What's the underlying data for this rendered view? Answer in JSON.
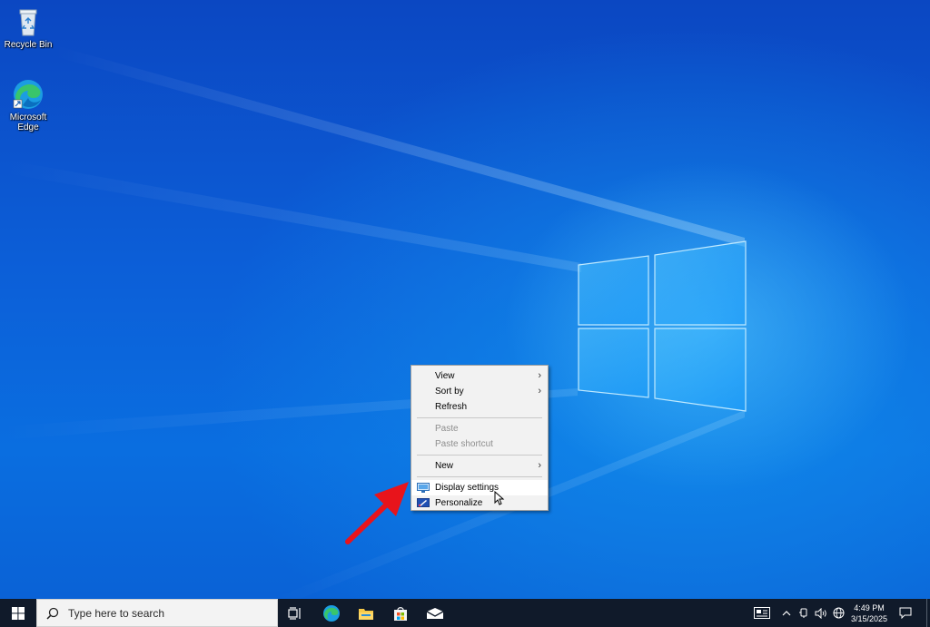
{
  "desktop": {
    "icons": [
      {
        "label": "Recycle Bin",
        "icon": "recycle-bin-icon"
      },
      {
        "label": "Microsoft Edge",
        "icon": "edge-icon"
      }
    ]
  },
  "context_menu": {
    "items": [
      {
        "label": "View",
        "submenu": true,
        "enabled": true
      },
      {
        "label": "Sort by",
        "submenu": true,
        "enabled": true
      },
      {
        "label": "Refresh",
        "submenu": false,
        "enabled": true
      },
      {
        "label": "Paste",
        "submenu": false,
        "enabled": false
      },
      {
        "label": "Paste shortcut",
        "submenu": false,
        "enabled": false
      },
      {
        "label": "New",
        "submenu": true,
        "enabled": true
      },
      {
        "label": "Display settings",
        "submenu": false,
        "enabled": true,
        "icon": "display-icon",
        "highlighted": true
      },
      {
        "label": "Personalize",
        "submenu": false,
        "enabled": true,
        "icon": "personalize-icon"
      }
    ],
    "submenu_glyph": "›"
  },
  "taskbar": {
    "search_placeholder": "Type here to search",
    "pinned": [
      "task-view-icon",
      "edge-icon",
      "file-explorer-icon",
      "store-icon",
      "mail-icon"
    ],
    "clock_time": "4:49 PM",
    "clock_date": "3/15/2025"
  },
  "colors": {
    "desktop_blue": "#0a4fc4",
    "taskbar": "#101a2a",
    "annotation_arrow": "#e8141b"
  }
}
